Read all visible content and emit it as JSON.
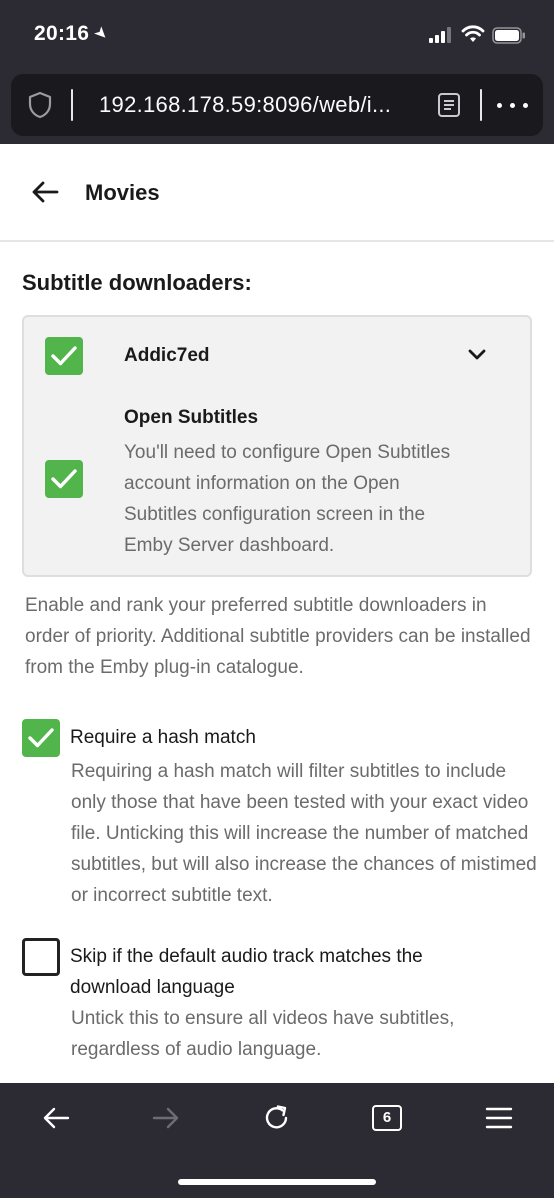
{
  "status_bar": {
    "time": "20:16"
  },
  "browser": {
    "url": "192.168.178.59:8096/web/i...",
    "tab_count": "6"
  },
  "header": {
    "title": "Movies"
  },
  "subtitles": {
    "section_title": "Subtitle downloaders:",
    "downloaders": [
      {
        "name": "Addic7ed",
        "checked": true
      },
      {
        "name": "Open Subtitles",
        "checked": true,
        "description": "You'll need to configure Open Subtitles account information on the Open Subtitles configuration screen in the Emby Server dashboard."
      }
    ],
    "help_text": "Enable and rank your preferred subtitle downloaders in order of priority. Additional subtitle providers can be installed from the Emby plug-in catalogue.",
    "options": [
      {
        "label": "Require a hash match",
        "checked": true,
        "description": "Requiring a hash match will filter subtitles to include only those that have been tested with your exact video file. Unticking this will increase the number of matched subtitles, but will also increase the chances of mistimed or incorrect subtitle text."
      },
      {
        "label": "Skip if the default audio track matches the download language",
        "checked": false,
        "description": "Untick this to ensure all videos have subtitles, regardless of audio language."
      }
    ]
  },
  "colors": {
    "accent_green": "#52b54b",
    "chrome_bg": "#2c2b33",
    "url_bar_bg": "#1a1a1e"
  },
  "icons": [
    "location-arrow-icon",
    "signal-icon",
    "wifi-icon",
    "battery-icon",
    "shield-icon",
    "reader-mode-icon",
    "more-icon",
    "back-arrow-icon",
    "checkmark-icon",
    "chevron-down-icon",
    "back-icon",
    "forward-icon",
    "reload-icon",
    "tabs-icon",
    "menu-icon"
  ]
}
